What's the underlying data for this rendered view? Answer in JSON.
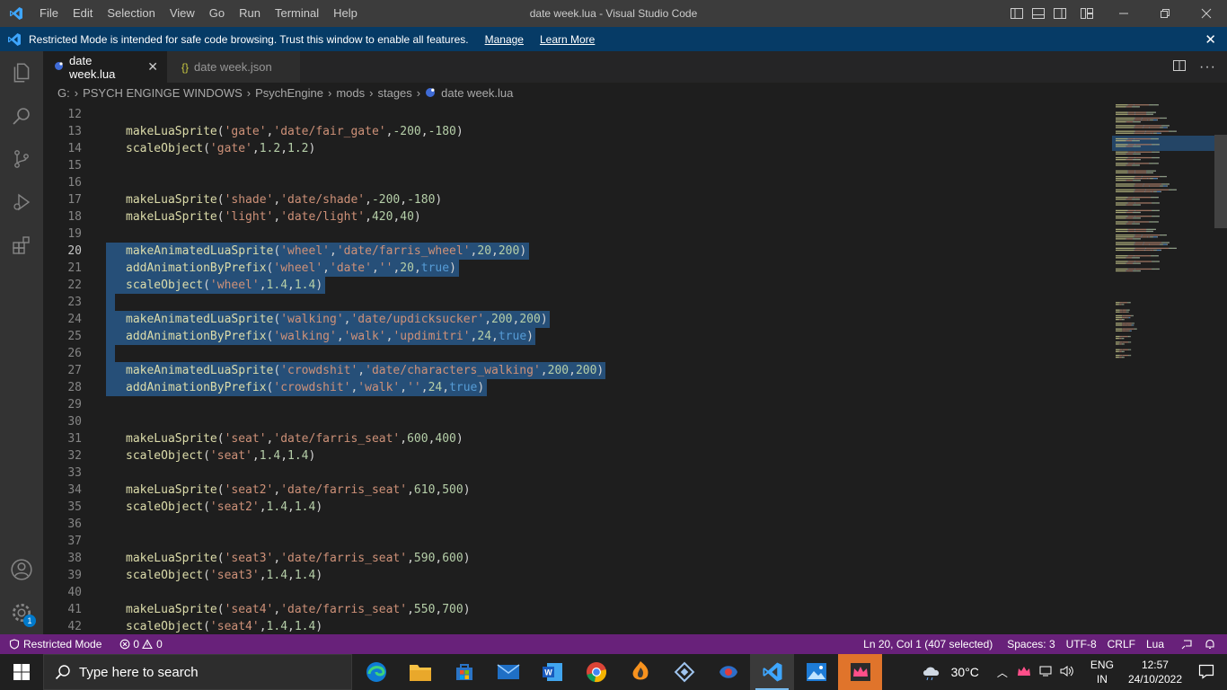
{
  "titlebar": {
    "menu": [
      "File",
      "Edit",
      "Selection",
      "View",
      "Go",
      "Run",
      "Terminal",
      "Help"
    ],
    "window_title": "date week.lua - Visual Studio Code"
  },
  "banner": {
    "message": "Restricted Mode is intended for safe code browsing. Trust this window to enable all features.",
    "manage": "Manage",
    "learn_more": "Learn More"
  },
  "tabs": [
    {
      "label": "date week.lua",
      "icon": "lua-file-icon",
      "active": true
    },
    {
      "label": "date week.json",
      "icon": "json-braces-icon",
      "active": false
    }
  ],
  "json_icon_glyph": "{}",
  "breadcrumb": [
    "G:",
    "PSYCH ENGINGE WINDOWS",
    "PsychEngine",
    "mods",
    "stages",
    "date week.lua"
  ],
  "editor": {
    "lines": [
      {
        "n": "12",
        "tokens": []
      },
      {
        "n": "13",
        "tokens": [
          [
            "f",
            "makeLuaSprite"
          ],
          [
            "p",
            "("
          ],
          [
            "s",
            "'gate'"
          ],
          [
            "p",
            ","
          ],
          [
            "s",
            "'date/fair_gate'"
          ],
          [
            "p",
            ","
          ],
          [
            "n",
            "-200"
          ],
          [
            "p",
            ","
          ],
          [
            "n",
            "-180"
          ],
          [
            "p",
            ")"
          ]
        ]
      },
      {
        "n": "14",
        "tokens": [
          [
            "f",
            "scaleObject"
          ],
          [
            "p",
            "("
          ],
          [
            "s",
            "'gate'"
          ],
          [
            "p",
            ","
          ],
          [
            "n",
            "1.2"
          ],
          [
            "p",
            ","
          ],
          [
            "n",
            "1.2"
          ],
          [
            "p",
            ")"
          ]
        ]
      },
      {
        "n": "15",
        "tokens": []
      },
      {
        "n": "16",
        "tokens": []
      },
      {
        "n": "17",
        "tokens": [
          [
            "f",
            "makeLuaSprite"
          ],
          [
            "p",
            "("
          ],
          [
            "s",
            "'shade'"
          ],
          [
            "p",
            ","
          ],
          [
            "s",
            "'date/shade'"
          ],
          [
            "p",
            ","
          ],
          [
            "n",
            "-200"
          ],
          [
            "p",
            ","
          ],
          [
            "n",
            "-180"
          ],
          [
            "p",
            ")"
          ]
        ]
      },
      {
        "n": "18",
        "tokens": [
          [
            "f",
            "makeLuaSprite"
          ],
          [
            "p",
            "("
          ],
          [
            "s",
            "'light'"
          ],
          [
            "p",
            ","
          ],
          [
            "s",
            "'date/light'"
          ],
          [
            "p",
            ","
          ],
          [
            "n",
            "420"
          ],
          [
            "p",
            ","
          ],
          [
            "n",
            "40"
          ],
          [
            "p",
            ")"
          ]
        ]
      },
      {
        "n": "19",
        "tokens": []
      },
      {
        "n": "20",
        "tokens": [
          [
            "f",
            "makeAnimatedLuaSprite"
          ],
          [
            "p",
            "("
          ],
          [
            "s",
            "'wheel'"
          ],
          [
            "p",
            ","
          ],
          [
            "s",
            "'date/farris_wheel'"
          ],
          [
            "p",
            ","
          ],
          [
            "n",
            "20"
          ],
          [
            "p",
            ","
          ],
          [
            "n",
            "200"
          ],
          [
            "p",
            ")"
          ]
        ]
      },
      {
        "n": "21",
        "tokens": [
          [
            "f",
            "addAnimationByPrefix"
          ],
          [
            "p",
            "("
          ],
          [
            "s",
            "'wheel'"
          ],
          [
            "p",
            ","
          ],
          [
            "s",
            "'date'"
          ],
          [
            "p",
            ","
          ],
          [
            "s",
            "''"
          ],
          [
            "p",
            ","
          ],
          [
            "n",
            "20"
          ],
          [
            "p",
            ","
          ],
          [
            "b",
            "true"
          ],
          [
            "p",
            ")"
          ]
        ]
      },
      {
        "n": "22",
        "tokens": [
          [
            "f",
            "scaleObject"
          ],
          [
            "p",
            "("
          ],
          [
            "s",
            "'wheel'"
          ],
          [
            "p",
            ","
          ],
          [
            "n",
            "1.4"
          ],
          [
            "p",
            ","
          ],
          [
            "n",
            "1.4"
          ],
          [
            "p",
            ")"
          ]
        ]
      },
      {
        "n": "23",
        "tokens": []
      },
      {
        "n": "24",
        "tokens": [
          [
            "f",
            "makeAnimatedLuaSprite"
          ],
          [
            "p",
            "("
          ],
          [
            "s",
            "'walking'"
          ],
          [
            "p",
            ","
          ],
          [
            "s",
            "'date/updicksucker'"
          ],
          [
            "p",
            ","
          ],
          [
            "n",
            "200"
          ],
          [
            "p",
            ","
          ],
          [
            "n",
            "200"
          ],
          [
            "p",
            ")"
          ]
        ]
      },
      {
        "n": "25",
        "tokens": [
          [
            "f",
            "addAnimationByPrefix"
          ],
          [
            "p",
            "("
          ],
          [
            "s",
            "'walking'"
          ],
          [
            "p",
            ","
          ],
          [
            "s",
            "'walk'"
          ],
          [
            "p",
            ","
          ],
          [
            "s",
            "'updimitri'"
          ],
          [
            "p",
            ","
          ],
          [
            "n",
            "24"
          ],
          [
            "p",
            ","
          ],
          [
            "b",
            "true"
          ],
          [
            "p",
            ")"
          ]
        ]
      },
      {
        "n": "26",
        "tokens": []
      },
      {
        "n": "27",
        "tokens": [
          [
            "f",
            "makeAnimatedLuaSprite"
          ],
          [
            "p",
            "("
          ],
          [
            "s",
            "'crowdshit'"
          ],
          [
            "p",
            ","
          ],
          [
            "s",
            "'date/characters_walking'"
          ],
          [
            "p",
            ","
          ],
          [
            "n",
            "200"
          ],
          [
            "p",
            ","
          ],
          [
            "n",
            "200"
          ],
          [
            "p",
            ")"
          ]
        ]
      },
      {
        "n": "28",
        "tokens": [
          [
            "f",
            "addAnimationByPrefix"
          ],
          [
            "p",
            "("
          ],
          [
            "s",
            "'crowdshit'"
          ],
          [
            "p",
            ","
          ],
          [
            "s",
            "'walk'"
          ],
          [
            "p",
            ","
          ],
          [
            "s",
            "''"
          ],
          [
            "p",
            ","
          ],
          [
            "n",
            "24"
          ],
          [
            "p",
            ","
          ],
          [
            "b",
            "true"
          ],
          [
            "p",
            ")"
          ]
        ]
      },
      {
        "n": "29",
        "tokens": []
      },
      {
        "n": "30",
        "tokens": []
      },
      {
        "n": "31",
        "tokens": [
          [
            "f",
            "makeLuaSprite"
          ],
          [
            "p",
            "("
          ],
          [
            "s",
            "'seat'"
          ],
          [
            "p",
            ","
          ],
          [
            "s",
            "'date/farris_seat'"
          ],
          [
            "p",
            ","
          ],
          [
            "n",
            "600"
          ],
          [
            "p",
            ","
          ],
          [
            "n",
            "400"
          ],
          [
            "p",
            ")"
          ]
        ]
      },
      {
        "n": "32",
        "tokens": [
          [
            "f",
            "scaleObject"
          ],
          [
            "p",
            "("
          ],
          [
            "s",
            "'seat'"
          ],
          [
            "p",
            ","
          ],
          [
            "n",
            "1.4"
          ],
          [
            "p",
            ","
          ],
          [
            "n",
            "1.4"
          ],
          [
            "p",
            ")"
          ]
        ]
      },
      {
        "n": "33",
        "tokens": []
      },
      {
        "n": "34",
        "tokens": [
          [
            "f",
            "makeLuaSprite"
          ],
          [
            "p",
            "("
          ],
          [
            "s",
            "'seat2'"
          ],
          [
            "p",
            ","
          ],
          [
            "s",
            "'date/farris_seat'"
          ],
          [
            "p",
            ","
          ],
          [
            "n",
            "610"
          ],
          [
            "p",
            ","
          ],
          [
            "n",
            "500"
          ],
          [
            "p",
            ")"
          ]
        ]
      },
      {
        "n": "35",
        "tokens": [
          [
            "f",
            "scaleObject"
          ],
          [
            "p",
            "("
          ],
          [
            "s",
            "'seat2'"
          ],
          [
            "p",
            ","
          ],
          [
            "n",
            "1.4"
          ],
          [
            "p",
            ","
          ],
          [
            "n",
            "1.4"
          ],
          [
            "p",
            ")"
          ]
        ]
      },
      {
        "n": "36",
        "tokens": []
      },
      {
        "n": "37",
        "tokens": []
      },
      {
        "n": "38",
        "tokens": [
          [
            "f",
            "makeLuaSprite"
          ],
          [
            "p",
            "("
          ],
          [
            "s",
            "'seat3'"
          ],
          [
            "p",
            ","
          ],
          [
            "s",
            "'date/farris_seat'"
          ],
          [
            "p",
            ","
          ],
          [
            "n",
            "590"
          ],
          [
            "p",
            ","
          ],
          [
            "n",
            "600"
          ],
          [
            "p",
            ")"
          ]
        ]
      },
      {
        "n": "39",
        "tokens": [
          [
            "f",
            "scaleObject"
          ],
          [
            "p",
            "("
          ],
          [
            "s",
            "'seat3'"
          ],
          [
            "p",
            ","
          ],
          [
            "n",
            "1.4"
          ],
          [
            "p",
            ","
          ],
          [
            "n",
            "1.4"
          ],
          [
            "p",
            ")"
          ]
        ]
      },
      {
        "n": "40",
        "tokens": []
      },
      {
        "n": "41",
        "tokens": [
          [
            "f",
            "makeLuaSprite"
          ],
          [
            "p",
            "("
          ],
          [
            "s",
            "'seat4'"
          ],
          [
            "p",
            ","
          ],
          [
            "s",
            "'date/farris_seat'"
          ],
          [
            "p",
            ","
          ],
          [
            "n",
            "550"
          ],
          [
            "p",
            ","
          ],
          [
            "n",
            "700"
          ],
          [
            "p",
            ")"
          ]
        ]
      },
      {
        "n": "42",
        "tokens": [
          [
            "f",
            "scaleObject"
          ],
          [
            "p",
            "("
          ],
          [
            "s",
            "'seat4'"
          ],
          [
            "p",
            ","
          ],
          [
            "n",
            "1.4"
          ],
          [
            "p",
            ","
          ],
          [
            "n",
            "1.4"
          ],
          [
            "p",
            ")"
          ]
        ]
      }
    ],
    "current_line": "20",
    "selected_lines": [
      "20",
      "21",
      "22",
      "23",
      "24",
      "25",
      "26",
      "27",
      "28"
    ]
  },
  "statusbar": {
    "restricted": "Restricted Mode",
    "errors": "0",
    "warnings": "0",
    "position": "Ln 20, Col 1 (407 selected)",
    "spaces": "Spaces: 3",
    "encoding": "UTF-8",
    "eol": "CRLF",
    "language": "Lua"
  },
  "activity_badge": "1",
  "taskbar": {
    "search_placeholder": "Type here to search",
    "weather": "30°C",
    "lang_top": "ENG",
    "lang_bottom": "IN",
    "time": "12:57",
    "date": "24/10/2022"
  },
  "colors": {
    "accent": "#007acc",
    "statusbar": "#68217a",
    "banner": "#063b66",
    "selection": "#264f78"
  }
}
